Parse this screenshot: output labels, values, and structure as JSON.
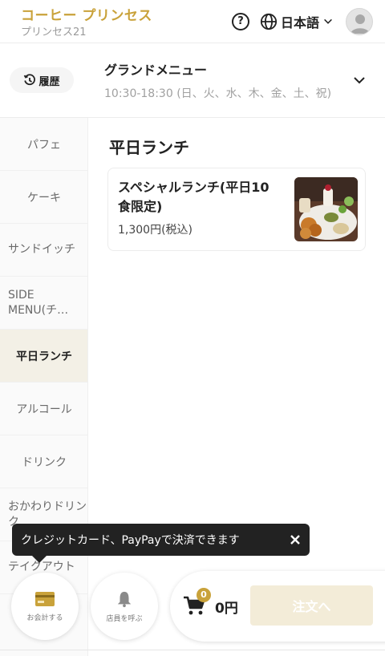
{
  "header": {
    "shop_name": "コーヒー プリンセス",
    "shop_sub": "プリンセス21",
    "help_symbol": "?",
    "language": "日本語"
  },
  "menu": {
    "history_label": "履歴",
    "title": "グランドメニュー",
    "hours": "10:30-18:30 (日、火、水、木、金、土、祝)"
  },
  "sidebar": {
    "items": [
      {
        "label": "パフェ"
      },
      {
        "label": "ケーキ"
      },
      {
        "label": "サンドイッチ"
      },
      {
        "label": "SIDE MENU(チ…"
      },
      {
        "label": "平日ランチ",
        "active": true
      },
      {
        "label": "アルコール"
      },
      {
        "label": "ドリンク"
      },
      {
        "label": "おかわりドリンク"
      },
      {
        "label": "テイクアウト"
      }
    ]
  },
  "section": {
    "title": "平日ランチ",
    "items": [
      {
        "name": "スペシャルランチ(平日10食限定)",
        "price": "1,300円(税込)"
      }
    ]
  },
  "tooltip": {
    "text": "クレジットカード、PayPayで決済できます",
    "close_symbol": "×"
  },
  "bottom": {
    "pay_label": "お会計する",
    "staff_label": "店員を呼ぶ",
    "cart_count": "0",
    "cart_total": "0円",
    "order_label": "注文へ"
  },
  "colors": {
    "accent": "#c9a23a",
    "active_bg": "#f3f0e6",
    "order_bg": "#f3ecd8"
  }
}
